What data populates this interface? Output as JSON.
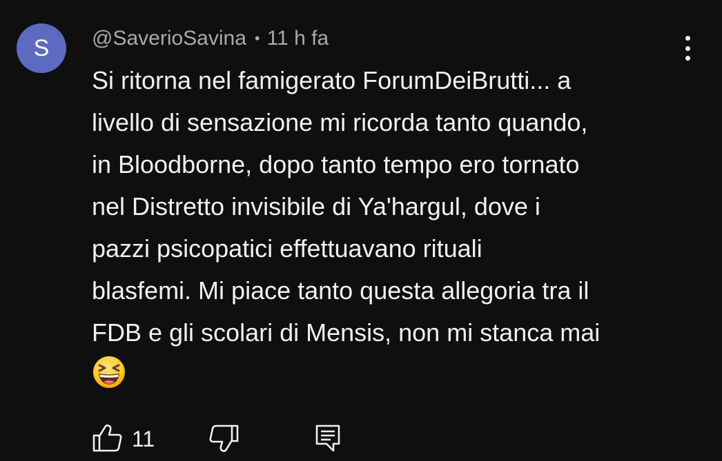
{
  "comment": {
    "avatar": {
      "letter": "S",
      "color": "#5c6bc0"
    },
    "author": "@SaverioSavina",
    "separator": "•",
    "time": "11 h fa",
    "lines": [
      "Si ritorna nel famigerato ForumDeiBrutti... a",
      "livello di sensazione mi ricorda tanto quando,",
      "in Bloodborne, dopo tanto tempo ero tornato",
      "nel Distretto invisibile di Ya'hargul, dove i",
      "pazzi psicopatici effettuavano rituali",
      "blasfemi. Mi piace tanto questa allegoria tra il",
      "FDB e gli scolari di Mensis, non mi stanca mai"
    ],
    "emoji": "grinning-squinting-face",
    "likes": "11",
    "icons": {
      "menu": "more-vertical-icon",
      "like": "thumbs-up-icon",
      "dislike": "thumbs-down-icon",
      "reply": "reply-comment-icon"
    }
  },
  "colors": {
    "background": "#0f0f0f",
    "text": "#f1f1f1",
    "secondary_text": "#aaaaaa",
    "emoji_face": "#ffca28"
  }
}
